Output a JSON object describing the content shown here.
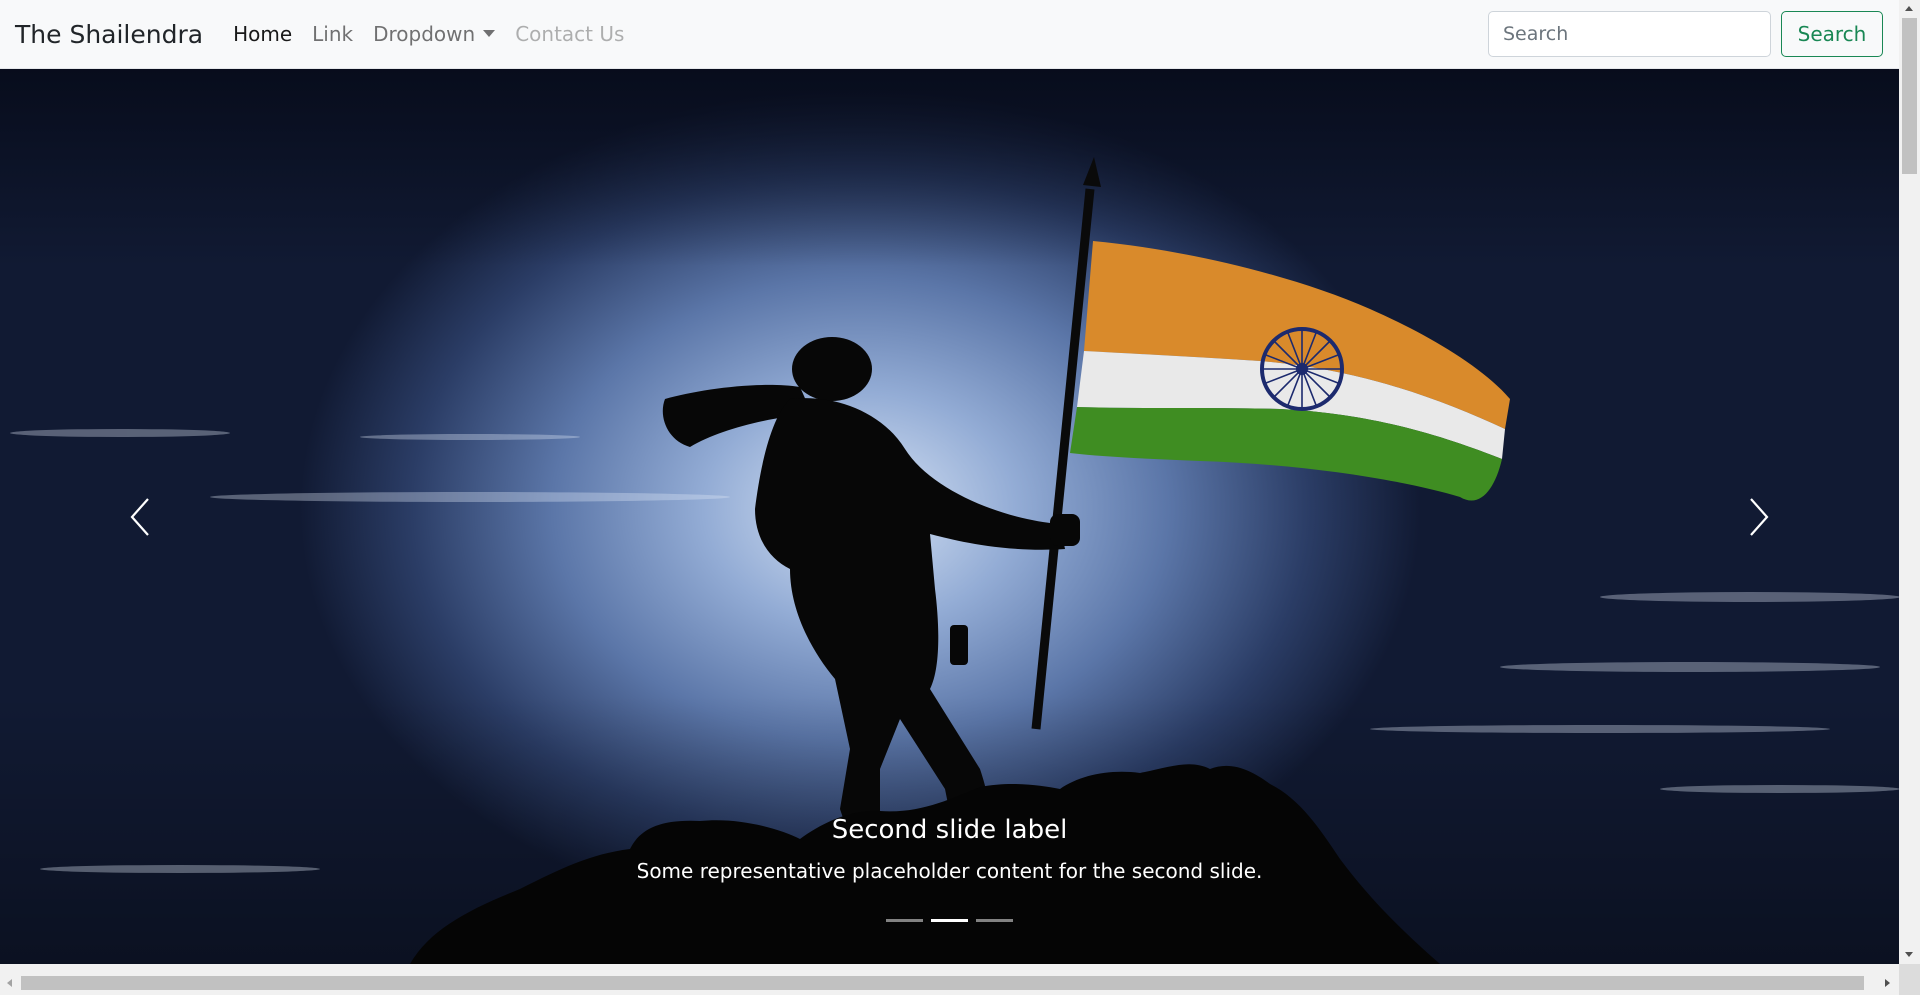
{
  "navbar": {
    "brand": "The Shailendra",
    "links": [
      {
        "label": "Home",
        "state": "active"
      },
      {
        "label": "Link",
        "state": "normal"
      },
      {
        "label": "Dropdown",
        "state": "dropdown"
      },
      {
        "label": "Contact Us",
        "state": "disabled"
      }
    ],
    "search": {
      "placeholder": "Search",
      "value": "",
      "button_label": "Search"
    }
  },
  "carousel": {
    "active_index": 1,
    "slide_count": 3,
    "caption": {
      "title": "Second slide label",
      "text": "Some representative placeholder content for the second slide."
    },
    "image_subject": "soldier-saluting-with-indian-flag-silhouette"
  },
  "colors": {
    "navbar_bg": "#f8f9fa",
    "search_button": "#198754",
    "flag_saffron": "#d98a2b",
    "flag_white": "#e9e9e9",
    "flag_green": "#3f8d22",
    "chakra": "#1c2a6e"
  }
}
